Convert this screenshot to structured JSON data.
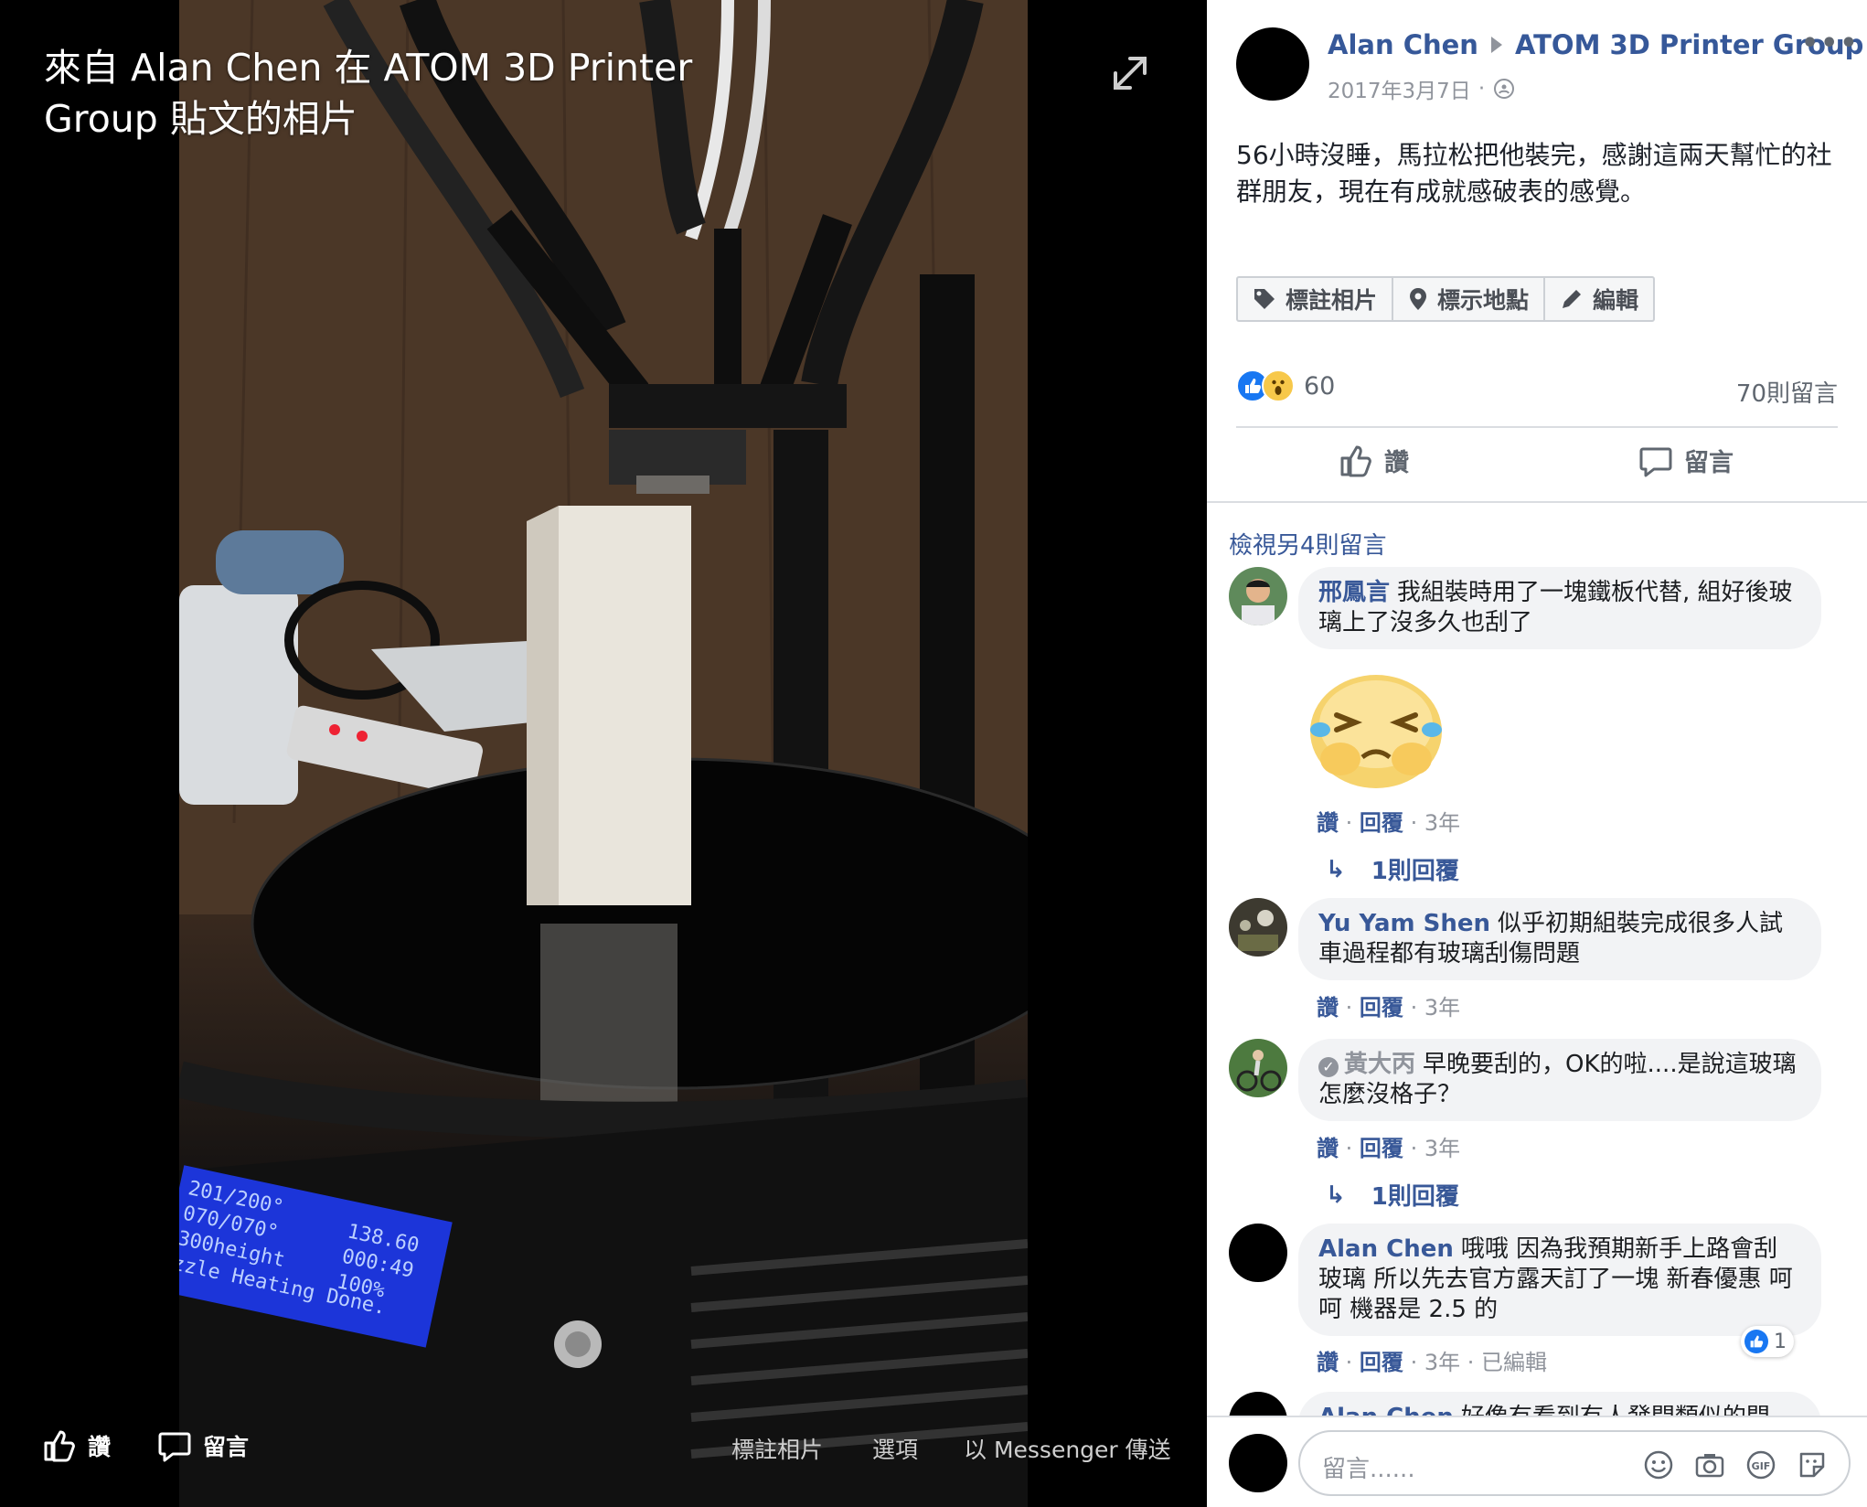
{
  "viewer": {
    "title": "來自 Alan Chen 在 ATOM 3D Printer Group 貼文的相片",
    "like_label": "讚",
    "comment_label": "留言",
    "tag_label": "標註相片",
    "options_label": "選項",
    "messenger_label": "以 Messenger 傳送",
    "lcd_lines": [
      "201/200°",
      "070/070°",
      "300height",
      "zzle Heating Done."
    ],
    "lcd_right": [
      "138.60",
      "000:49",
      "100%"
    ]
  },
  "post": {
    "author": "Alan Chen",
    "group": "ATOM 3D Printer Group",
    "more": "•••",
    "date": "2017年3月7日",
    "date_sep": "·",
    "text": "56小時沒睡，馬拉松把他裝完，感謝這兩天幫忙的社群朋友，現在有成就感破表的感覺。",
    "tag_photo": "標註相片",
    "add_location": "標示地點",
    "edit": "編輯",
    "reaction_count": "60",
    "comment_count": "70則留言",
    "like_action": "讚",
    "comment_action": "留言"
  },
  "comments": {
    "view_more": "檢視另4則留言",
    "items": [
      {
        "name": "邢鳳言",
        "text": "我組裝時用了一塊鐵板代替, 組好後玻璃上了沒多久也刮了",
        "like": "讚",
        "reply": "回覆",
        "time": "3年",
        "replies": "1則回覆"
      },
      {
        "name": "Yu Yam Shen",
        "text": "似乎初期組裝完成很多人試車過程都有玻璃刮傷問題",
        "like": "讚",
        "reply": "回覆",
        "time": "3年"
      },
      {
        "name": "黃大丙",
        "text": "早晚要刮的，OK的啦....是說這玻璃怎麼沒格子？",
        "like": "讚",
        "reply": "回覆",
        "time": "3年",
        "replies": "1則回覆"
      },
      {
        "name": "Alan Chen",
        "text": "哦哦 因為我預期新手上路會刮玻璃 所以先去官方露天訂了一塊 新春優惠 呵呵 機器是 2.5 的",
        "like": "讚",
        "reply": "回覆",
        "time": "3年",
        "edited": "已編輯",
        "like_count": "1"
      },
      {
        "name": "Alan Chen",
        "text": "好像有看到有人發問類似的問"
      }
    ],
    "dot": "·"
  },
  "composer": {
    "placeholder": "留言......"
  },
  "icons": [
    "expand-icon",
    "like-icon",
    "comment-icon",
    "tag-icon",
    "location-pin-icon",
    "pencil-icon",
    "globe-icon",
    "emoji-icon",
    "camera-icon",
    "gif-icon",
    "sticker-icon",
    "reply-arrow-icon",
    "crying-emoji-sticker"
  ],
  "colors": {
    "link": "#385898",
    "like_blue": "#1877f2",
    "bubble": "#f2f3f5",
    "meta_gray": "#90949c"
  }
}
